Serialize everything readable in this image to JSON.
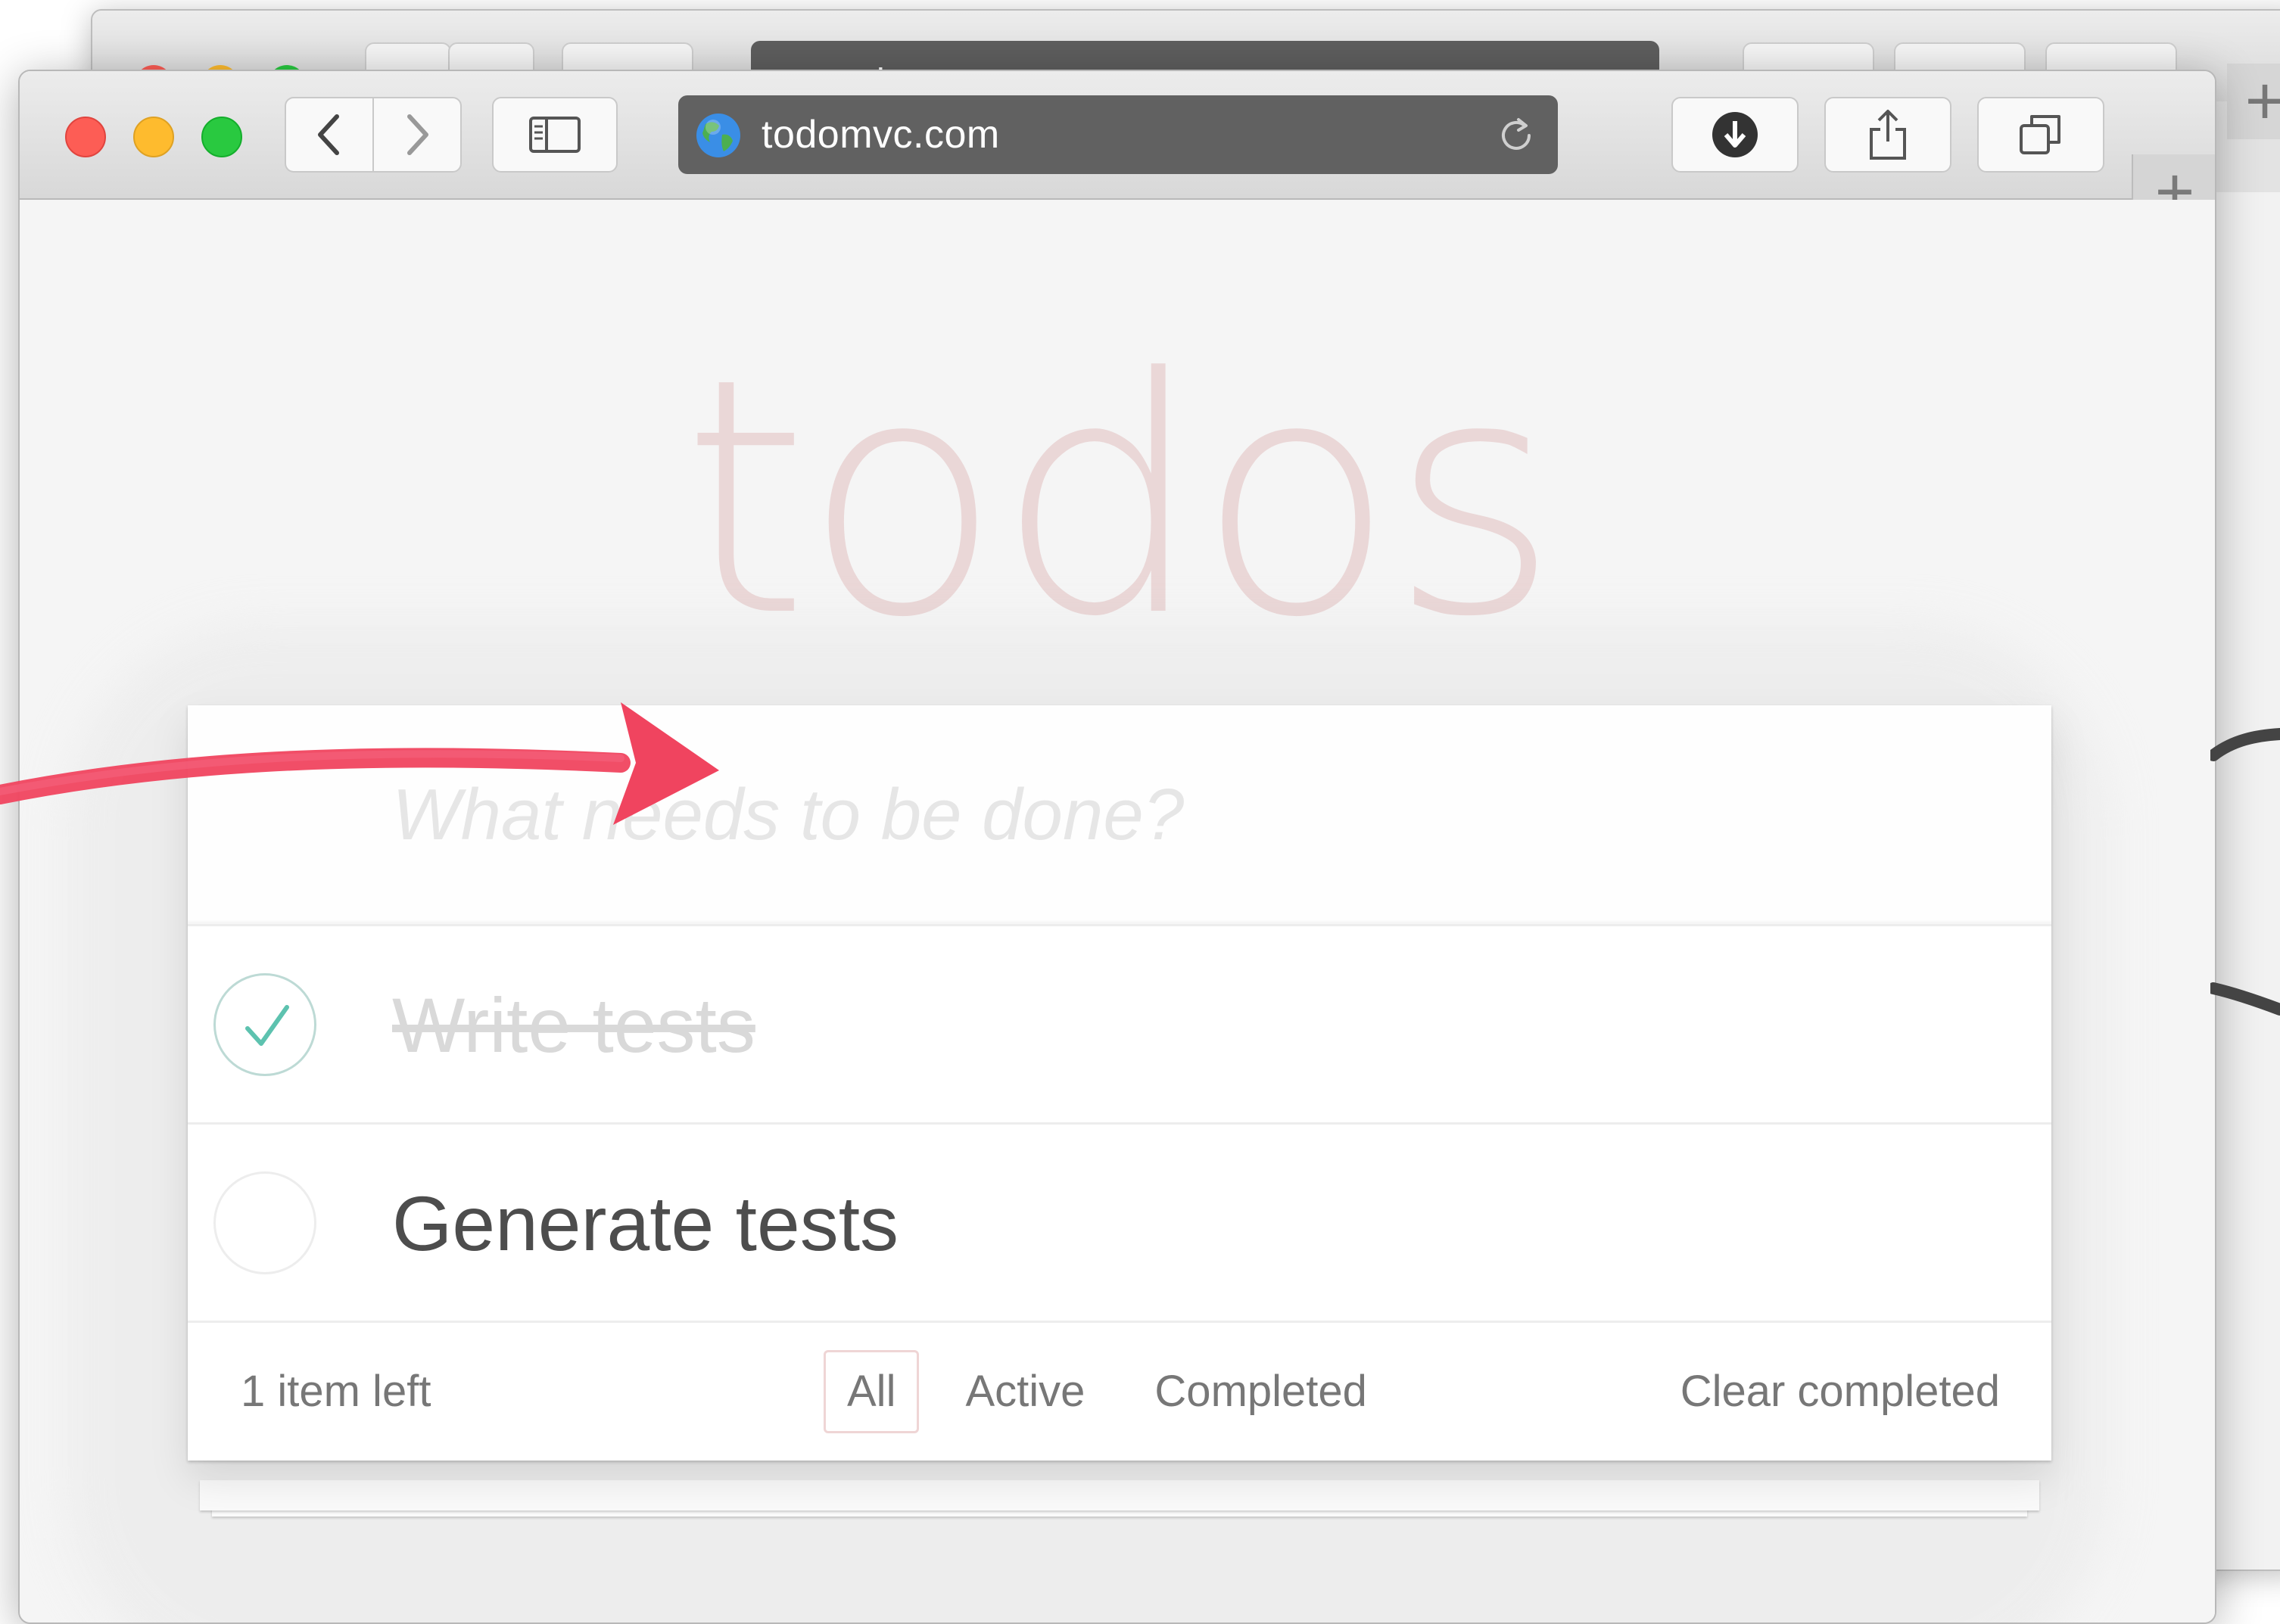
{
  "browser": {
    "url": "todomvc.com",
    "back_window_url": "todomvc.com",
    "new_tab_symbol": "+",
    "traffic_lights": {
      "close": "#fd5d55",
      "minimize": "#febb2e",
      "zoom": "#29c940"
    },
    "address_bar_color": "#616161"
  },
  "app": {
    "title": "todos",
    "title_color": "rgba(175,47,47,0.15)",
    "new_todo_placeholder": "What needs to be done?",
    "todos": [
      {
        "label": "Write tests",
        "completed": true
      },
      {
        "label": "Generate tests",
        "completed": false
      }
    ],
    "footer": {
      "count_text": "1 item left",
      "filters": [
        {
          "label": "All",
          "selected": true
        },
        {
          "label": "Active",
          "selected": false
        },
        {
          "label": "Completed",
          "selected": false
        }
      ],
      "clear_label": "Clear completed"
    },
    "check_color": "#5dc2af"
  },
  "annotations": {
    "arrow_color": "#f0445f",
    "scribble_color": "#444444"
  }
}
